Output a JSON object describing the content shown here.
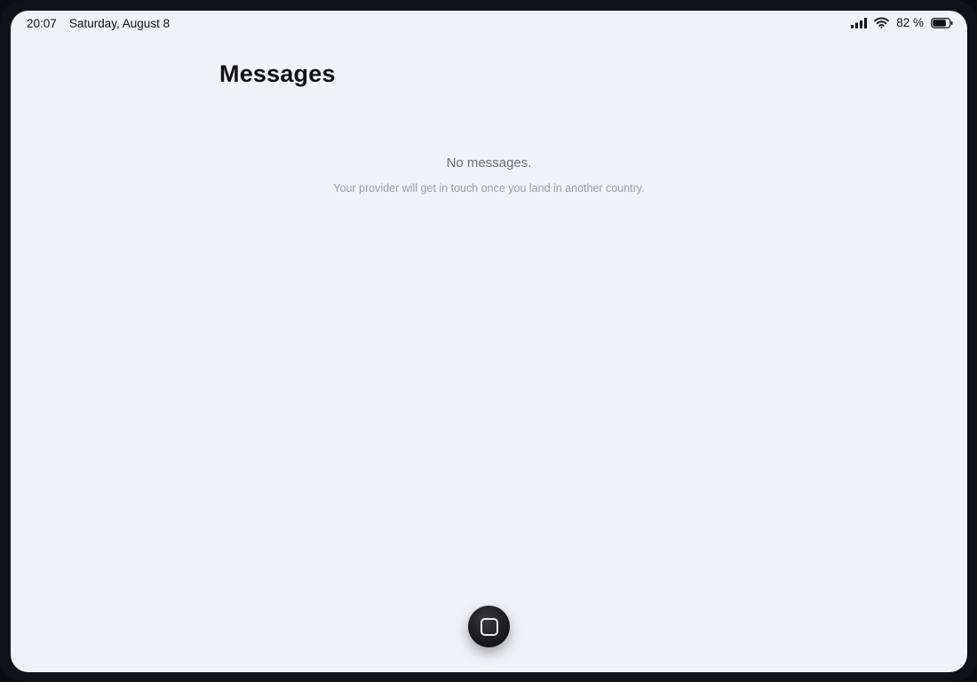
{
  "status_bar": {
    "time": "20:07",
    "date": "Saturday, August 8",
    "battery_percent": "82 %",
    "battery_level": 0.82,
    "icons": [
      "signal-icon",
      "wifi-icon",
      "battery-icon"
    ]
  },
  "page": {
    "title": "Messages"
  },
  "empty_state": {
    "title": "No messages.",
    "subtitle": "Your provider will get in touch once you land in another country."
  },
  "home": {
    "icon": "home-square-icon"
  },
  "colors": {
    "background": "#f1f2f6",
    "frame": "#111216",
    "title_text": "#111111",
    "muted_text": "#6e6e73",
    "subtle_text": "#9a9aa0"
  }
}
